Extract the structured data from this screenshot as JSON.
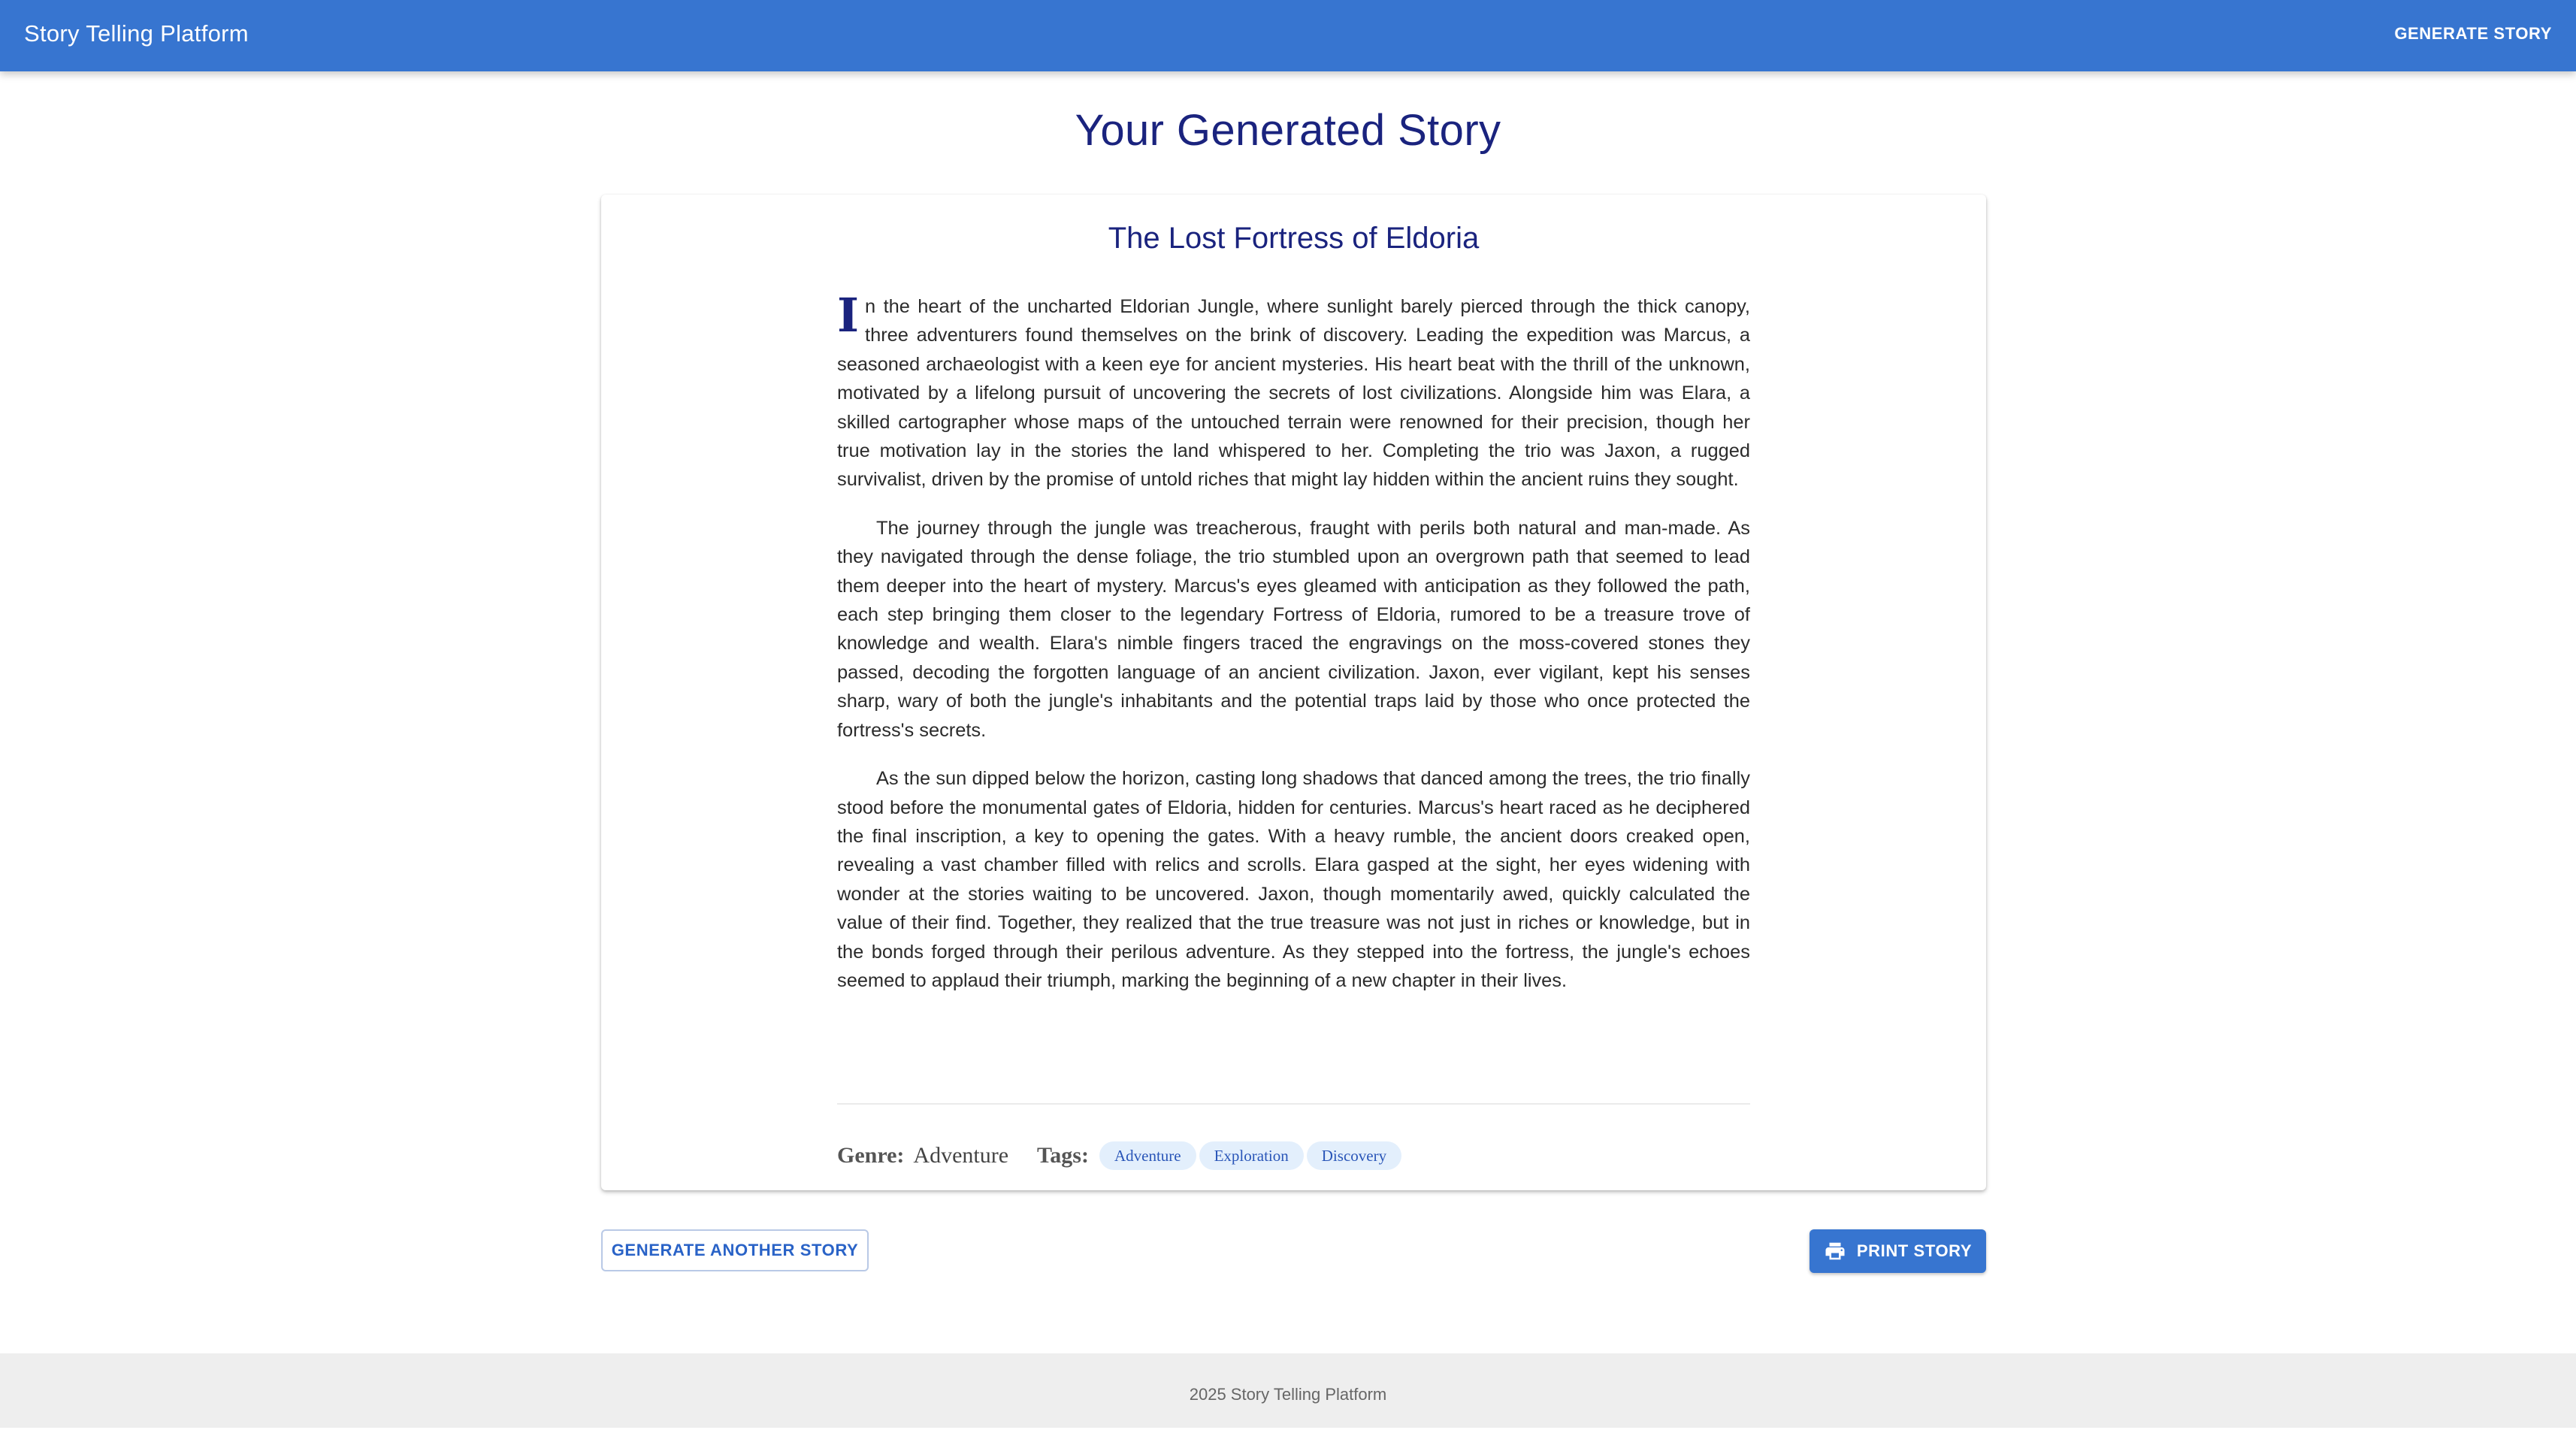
{
  "app": {
    "title": "Story Telling Platform",
    "nav_button": "GENERATE STORY",
    "accent_color": "#3775d0",
    "heading_color": "#1a237e"
  },
  "page": {
    "title": "Your Generated Story"
  },
  "story": {
    "title": "The Lost Fortress of Eldoria",
    "dropcap": "I",
    "paragraph1_rest": "n the heart of the uncharted Eldorian Jungle, where sunlight barely pierced through the thick canopy, three adventurers found themselves on the brink of discovery. Leading the expedition was Marcus, a seasoned archaeologist with a keen eye for ancient mysteries. His heart beat with the thrill of the unknown, motivated by a lifelong pursuit of uncovering the secrets of lost civilizations. Alongside him was Elara, a skilled cartographer whose maps of the untouched terrain were renowned for their precision, though her true motivation lay in the stories the land whispered to her. Completing the trio was Jaxon, a rugged survivalist, driven by the promise of untold riches that might lay hidden within the ancient ruins they sought.",
    "paragraph2": "The journey through the jungle was treacherous, fraught with perils both natural and man-made. As they navigated through the dense foliage, the trio stumbled upon an overgrown path that seemed to lead them deeper into the heart of mystery. Marcus's eyes gleamed with anticipation as they followed the path, each step bringing them closer to the legendary Fortress of Eldoria, rumored to be a treasure trove of knowledge and wealth. Elara's nimble fingers traced the engravings on the moss-covered stones they passed, decoding the forgotten language of an ancient civilization. Jaxon, ever vigilant, kept his senses sharp, wary of both the jungle's inhabitants and the potential traps laid by those who once protected the fortress's secrets.",
    "paragraph3": "As the sun dipped below the horizon, casting long shadows that danced among the trees, the trio finally stood before the monumental gates of Eldoria, hidden for centuries. Marcus's heart raced as he deciphered the final inscription, a key to opening the gates. With a heavy rumble, the ancient doors creaked open, revealing a vast chamber filled with relics and scrolls. Elara gasped at the sight, her eyes widening with wonder at the stories waiting to be uncovered. Jaxon, though momentarily awed, quickly calculated the value of their find. Together, they realized that the true treasure was not just in riches or knowledge, but in the bonds forged through their perilous adventure. As they stepped into the fortress, the jungle's echoes seemed to applaud their triumph, marking the beginning of a new chapter in their lives.",
    "genre_label": "Genre:",
    "genre_value": "Adventure",
    "tags_label": "Tags:",
    "tags": [
      "Adventure",
      "Exploration",
      "Discovery"
    ]
  },
  "actions": {
    "generate_another": "GENERATE ANOTHER STORY",
    "print_story": "PRINT STORY",
    "print_icon": "printer-icon"
  },
  "footer": {
    "text": "2025 Story Telling Platform"
  }
}
